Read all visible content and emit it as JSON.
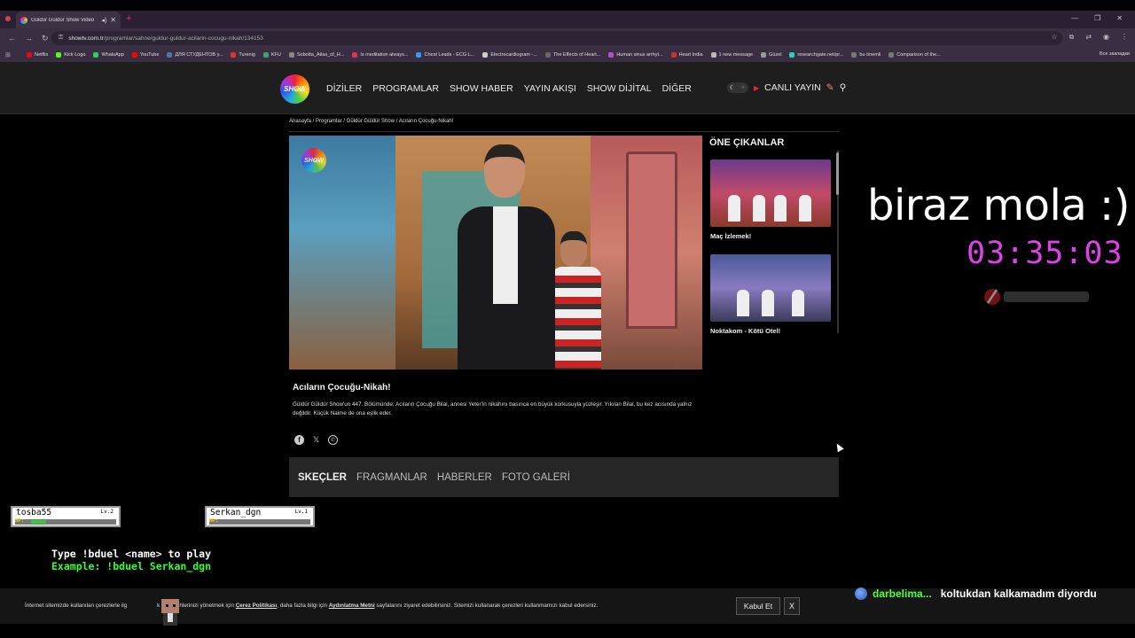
{
  "browser": {
    "tab_title": "Güldür Güldür Show Video",
    "url_host": "showtv.com.tr",
    "url_path": "/programlar/sahne/guldur-guldur-acilarin-cocugu-nikah/134153",
    "bookmarks": [
      {
        "label": "Netflix",
        "color": "#e50914"
      },
      {
        "label": "Kick Logo",
        "color": "#53fc18"
      },
      {
        "label": "WhatsApp",
        "color": "#25d366"
      },
      {
        "label": "YouTube",
        "color": "#ff0000"
      },
      {
        "label": "ДЛЯ СТУДЕНТОВ у...",
        "color": "#4a76a8"
      },
      {
        "label": "Turenig",
        "color": "#d33"
      },
      {
        "label": "KFU",
        "color": "#3a6"
      },
      {
        "label": "Sobotta_Atlas_of_H...",
        "color": "#888"
      },
      {
        "label": "Is meditation always...",
        "color": "#d35"
      },
      {
        "label": "Chest Leads - ECG L...",
        "color": "#39f"
      },
      {
        "label": "Electrocardiogram -...",
        "color": "#ccc"
      },
      {
        "label": "The Effects of Heart...",
        "color": "#666"
      },
      {
        "label": "Human sinus arrhyt...",
        "color": "#a5c"
      },
      {
        "label": "Heart India",
        "color": "#c33"
      },
      {
        "label": "1 new message",
        "color": "#bbb"
      },
      {
        "label": "Güzel",
        "color": "#999"
      },
      {
        "label": "researchgate.net/pr...",
        "color": "#3cb"
      },
      {
        "label": "bu önemli",
        "color": "#777"
      },
      {
        "label": "Comparison of the...",
        "color": "#777"
      }
    ],
    "all_bookmarks": "Все закладки"
  },
  "site": {
    "logo": "SHOW",
    "nav": [
      "DİZİLER",
      "PROGRAMLAR",
      "SHOW HABER",
      "YAYIN AKIŞI",
      "SHOW DİJİTAL",
      "DİĞER"
    ],
    "live": "CANLI YAYIN"
  },
  "breadcrumb": "Anasayfa / Programlar / Güldür Güldür Show / Acıların Çocuğu-Nikah!",
  "featured": {
    "heading": "ÖNE ÇIKANLAR",
    "items": [
      {
        "caption": "Maç İzlemek!"
      },
      {
        "caption": "Noktakom - Kötü Otel!"
      }
    ]
  },
  "article": {
    "title": "Acıların Çocuğu-Nikah!",
    "description": "Güldür Güldür Show'un 447. Bölümünde; Acıların Çocuğu Bilal, annesi Yeter'in nikahını basınca en büyük korkusuyla yüzleşir. Yıkılan Bilal, bu kez acısında yalnız değildir. Küçük Naime de ona eşlik eder."
  },
  "tabs": [
    "SKEÇLER",
    "FRAGMANLAR",
    "HABERLER",
    "FOTO GALERİ"
  ],
  "overlay": {
    "mola": "biraz mola :)",
    "timer": "03:35:03",
    "duel": {
      "p1": {
        "name": "tosba55",
        "level": "Lv.2",
        "hp_label": "HP:",
        "hp": 0.18
      },
      "p2": {
        "name": "Serkan_dgn",
        "level": "Lv.1",
        "hp_label": "HP:",
        "hp": 0.0
      },
      "line1": "Type !bduel <name> to play",
      "line2": "Example: !bduel Serkan_dgn"
    },
    "chat": {
      "user": "darbelima...",
      "message": "koltukdan kalkamadım diyordu"
    }
  },
  "cookie": {
    "text_a": "İnternet sitemizde kullanılan çerezlerle ilg",
    "text_b": "k ve tercihlerinizi yönetmek için ",
    "link1": "Çerez Politikası",
    "text_c": ", daha fazla bilgi için ",
    "link2": "Aydınlatma Metni",
    "text_d": " sayfalarını ziyaret edebilirsiniz. Sitemizi kullanarak çerezleri kullanmamızı kabul edersiniz.",
    "accept": "Kabul Et",
    "close": "X"
  }
}
